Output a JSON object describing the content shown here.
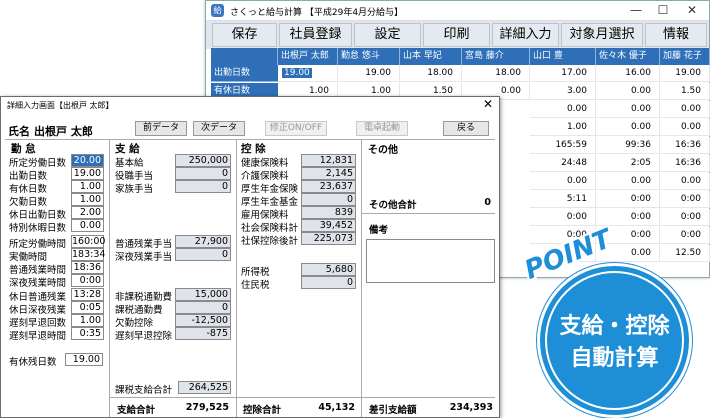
{
  "back_window": {
    "title": "さくっと給与計算 【平成29年4月分給与】",
    "toolbar": [
      "保存",
      "社員登録",
      "設定",
      "印刷",
      "詳細入力",
      "対象月選択",
      "情報"
    ],
    "columns": [
      "出根戸 太郎",
      "勤怠 悠斗",
      "山本 早妃",
      "宮島 藤介",
      "山口 豊",
      "佐々木 優子",
      "加藤 花子"
    ],
    "row_labels": [
      "出勤日数",
      "有休日数"
    ],
    "rows": [
      [
        "19.00",
        "19.00",
        "18.00",
        "18.00",
        "17.00",
        "16.00",
        "19.00"
      ],
      [
        "1.00",
        "1.00",
        "1.50",
        "0.00",
        "3.00",
        "0.00",
        "1.50"
      ],
      [
        "",
        "",
        "",
        "",
        "0.00",
        "0.00",
        "0.00"
      ],
      [
        "",
        "",
        "",
        "",
        "1.00",
        "0.00",
        "0.00"
      ],
      [
        "",
        "",
        "",
        "",
        "165:59",
        "99:36",
        "16:36"
      ],
      [
        "",
        "",
        "",
        "",
        "24:48",
        "2:05",
        "16:36"
      ],
      [
        "",
        "",
        "",
        "",
        "0.00",
        "0.00",
        "0.00"
      ],
      [
        "",
        "",
        "",
        "",
        "5:11",
        "0:00",
        "0:00"
      ],
      [
        "",
        "",
        "",
        "",
        "0:00",
        "0:00",
        "0:00"
      ],
      [
        "",
        "",
        "",
        "",
        "0:00",
        "0:00",
        "0:00"
      ],
      [
        "",
        "",
        "",
        "",
        "0.00",
        "0.00",
        "12.50"
      ]
    ]
  },
  "dialog": {
    "title": "詳細入力画面【出根戸 太郎】",
    "name_label": "氏名",
    "name": "出根戸 太郎",
    "buttons": {
      "prev": "前データ",
      "next": "次データ",
      "toggle": "修正ON/OFF",
      "calc": "電卓起動",
      "back": "戻る"
    },
    "attendance": {
      "header": "勤 怠",
      "items": [
        {
          "label": "所定労働日数",
          "value": "20.00"
        },
        {
          "label": "出勤日数",
          "value": "19.00"
        },
        {
          "label": "有休日数",
          "value": "1.00"
        },
        {
          "label": "欠勤日数",
          "value": "1.00"
        },
        {
          "label": "休日出勤日数",
          "value": "2.00"
        },
        {
          "label": "特別休暇日数",
          "value": "0.00"
        },
        {
          "label": "所定労働時間",
          "value": "160:00"
        },
        {
          "label": "実働時間",
          "value": "183:34"
        },
        {
          "label": "普通残業時間",
          "value": "18:36"
        },
        {
          "label": "深夜残業時間",
          "value": "0:00"
        },
        {
          "label": "休日普通残業",
          "value": "13:28"
        },
        {
          "label": "休日深夜残業",
          "value": "0:05"
        },
        {
          "label": "遅刻早退回数",
          "value": "1.00"
        },
        {
          "label": "遅刻早退時間",
          "value": "0:35"
        }
      ],
      "remaining_label": "有休残日数",
      "remaining_value": "19.00"
    },
    "pay": {
      "header": "支 給",
      "items": [
        {
          "label": "基本給",
          "value": "250,000"
        },
        {
          "label": "役職手当",
          "value": "0"
        },
        {
          "label": "家族手当",
          "value": "0"
        }
      ],
      "items2": [
        {
          "label": "普通残業手当",
          "value": "27,900"
        },
        {
          "label": "深夜残業手当",
          "value": "0"
        }
      ],
      "items3": [
        {
          "label": "非課税通勤費",
          "value": "15,000"
        },
        {
          "label": "課税通勤費",
          "value": "0"
        },
        {
          "label": "欠勤控除",
          "value": "-12,500"
        },
        {
          "label": "遅刻早退控除",
          "value": "-875"
        }
      ],
      "taxable_label": "課税支給合計",
      "taxable_value": "264,525",
      "total_label": "支給合計",
      "total_value": "279,525"
    },
    "deduct": {
      "header": "控 除",
      "items": [
        {
          "label": "健康保険料",
          "value": "12,831"
        },
        {
          "label": "介護保険料",
          "value": "2,145"
        },
        {
          "label": "厚生年金保険",
          "value": "23,637"
        },
        {
          "label": "厚生年金基金",
          "value": "0"
        },
        {
          "label": "雇用保険料",
          "value": "839"
        },
        {
          "label": "社会保険料計",
          "value": "39,452"
        },
        {
          "label": "社保控除後計",
          "value": "225,073"
        }
      ],
      "items2": [
        {
          "label": "所得税",
          "value": "5,680"
        },
        {
          "label": "住民税",
          "value": "0"
        }
      ],
      "total_label": "控除合計",
      "total_value": "45,132"
    },
    "other": {
      "header": "その他",
      "total_label": "その他合計",
      "total_value": "0",
      "note_label": "備考",
      "net_label": "差引支給額",
      "net_value": "234,393"
    }
  },
  "badge": {
    "point": "POINT",
    "line1": "支給・控除",
    "line2": "自動計算"
  },
  "colors": {
    "accent": "#2e6fb7",
    "badge": "#1e8ed7"
  }
}
